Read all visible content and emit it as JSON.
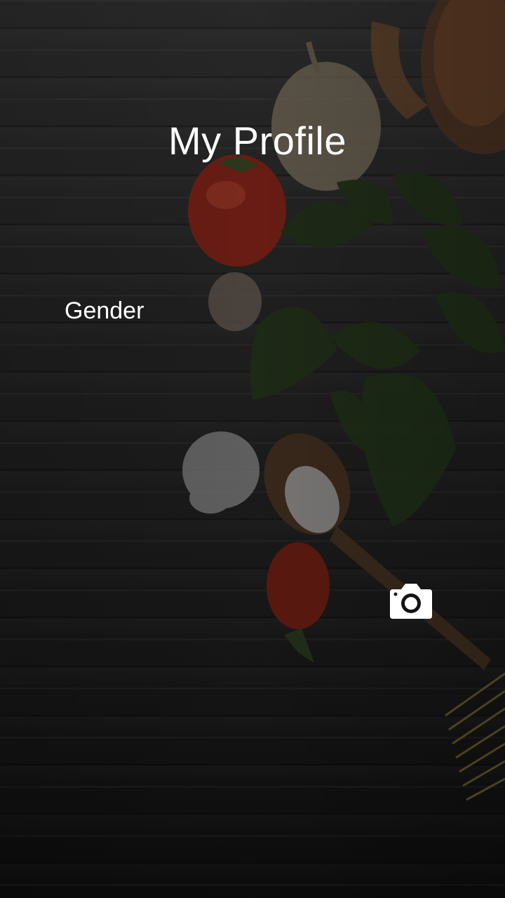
{
  "header": {
    "title": "My Profile"
  },
  "form": {
    "gender_label": "Gender"
  },
  "actions": {
    "camera_icon": "camera-icon"
  },
  "background": {
    "image": "dark wood table with vegetables, herbs and pasta"
  }
}
